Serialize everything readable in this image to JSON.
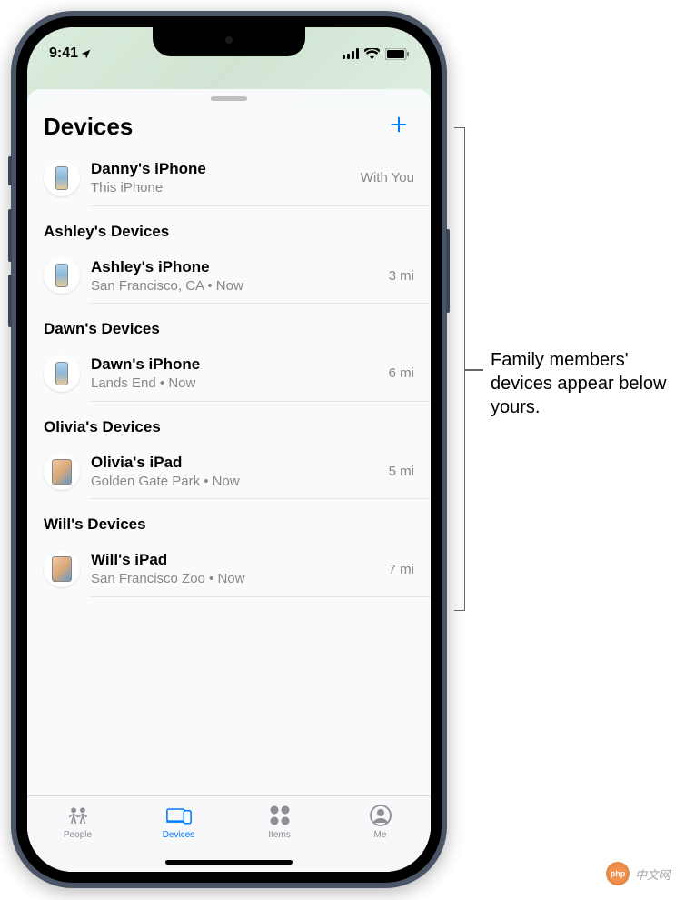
{
  "status": {
    "time": "9:41"
  },
  "sheet": {
    "title": "Devices"
  },
  "own_device": {
    "name": "Danny's iPhone",
    "sub": "This iPhone",
    "dist": "With You"
  },
  "sections": [
    {
      "header": "Ashley's Devices",
      "device": {
        "name": "Ashley's iPhone",
        "sub": "San Francisco, CA • Now",
        "dist": "3 mi",
        "type": "phone"
      }
    },
    {
      "header": "Dawn's Devices",
      "device": {
        "name": "Dawn's iPhone",
        "sub": "Lands End • Now",
        "dist": "6 mi",
        "type": "phone"
      }
    },
    {
      "header": "Olivia's Devices",
      "device": {
        "name": "Olivia's iPad",
        "sub": "Golden Gate Park • Now",
        "dist": "5 mi",
        "type": "ipad"
      }
    },
    {
      "header": "Will's Devices",
      "device": {
        "name": "Will's iPad",
        "sub": "San Francisco Zoo • Now",
        "dist": "7 mi",
        "type": "ipad"
      }
    }
  ],
  "tabs": [
    {
      "label": "People",
      "active": false
    },
    {
      "label": "Devices",
      "active": true
    },
    {
      "label": "Items",
      "active": false
    },
    {
      "label": "Me",
      "active": false
    }
  ],
  "callout": "Family members' devices appear below yours.",
  "watermark": "中文网"
}
